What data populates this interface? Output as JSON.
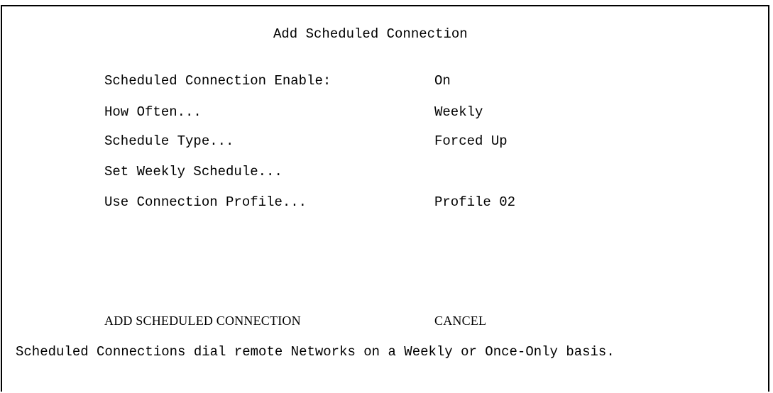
{
  "screen": {
    "title": "Add Scheduled Connection"
  },
  "fields": [
    {
      "label": "Scheduled Connection Enable:",
      "value": "On"
    },
    {
      "label": "How Often...",
      "value": "Weekly"
    },
    {
      "label": "Schedule Type...",
      "value": "Forced Up"
    },
    {
      "label": "Set Weekly Schedule...",
      "value": ""
    },
    {
      "label": "Use Connection Profile...",
      "value": "Profile 02"
    }
  ],
  "actions": {
    "add_label": "ADD SCHEDULED CONNECTION",
    "cancel_label": "CANCEL"
  },
  "status_line": "Scheduled Connections dial remote Networks on a Weekly or Once-Only basis."
}
